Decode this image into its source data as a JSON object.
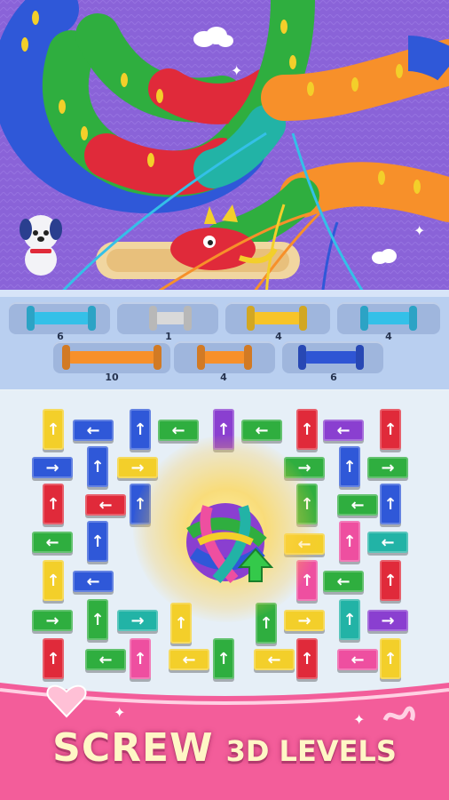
{
  "headline": {
    "word1": "SCREW",
    "word2": "3D LEVELS"
  },
  "spools_top": [
    {
      "color": "#34c0e8",
      "count": "6"
    },
    {
      "color": "#d9d9d9",
      "count": "1"
    },
    {
      "color": "#f7c428",
      "count": "4"
    },
    {
      "color": "#34c0e8",
      "count": "4"
    }
  ],
  "spools_bottom": [
    {
      "color": "#f7902a",
      "count": "10"
    },
    {
      "color": "#f7902a",
      "count": "4"
    },
    {
      "color": "#2f55d4",
      "count": "6"
    }
  ],
  "colors": {
    "red": "#e02a3a",
    "green": "#2fae3f",
    "blue": "#2f58d8",
    "yellow": "#f3cf2a",
    "purple": "#8a3fd0",
    "pink": "#ee4fa0",
    "teal": "#22b3a6",
    "orange": "#f7902a",
    "scene_bg": "#8a63d8",
    "banner": "#f35d9a"
  },
  "icons": [
    "arrow-up-icon",
    "arrow-left-icon",
    "arrow-right-icon",
    "yarn-ball-icon",
    "heart-icon",
    "dog-icon",
    "dragon-icon",
    "cloud-icon",
    "sparkle-icon"
  ]
}
